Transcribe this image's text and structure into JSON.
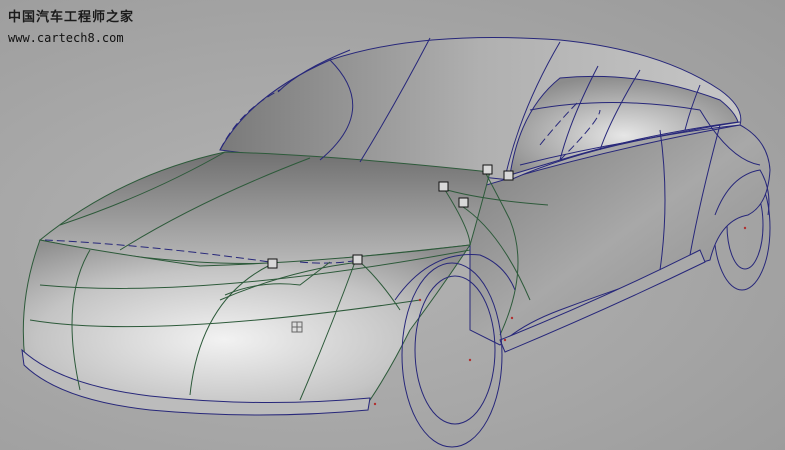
{
  "watermark": {
    "title": "中国汽车工程师之家",
    "url": "www.cartech8.com"
  },
  "colors": {
    "background": "#a3a3a3",
    "curve_blue": "#27277a",
    "curve_green": "#2d5a3a",
    "cv_red": "#b03030"
  }
}
